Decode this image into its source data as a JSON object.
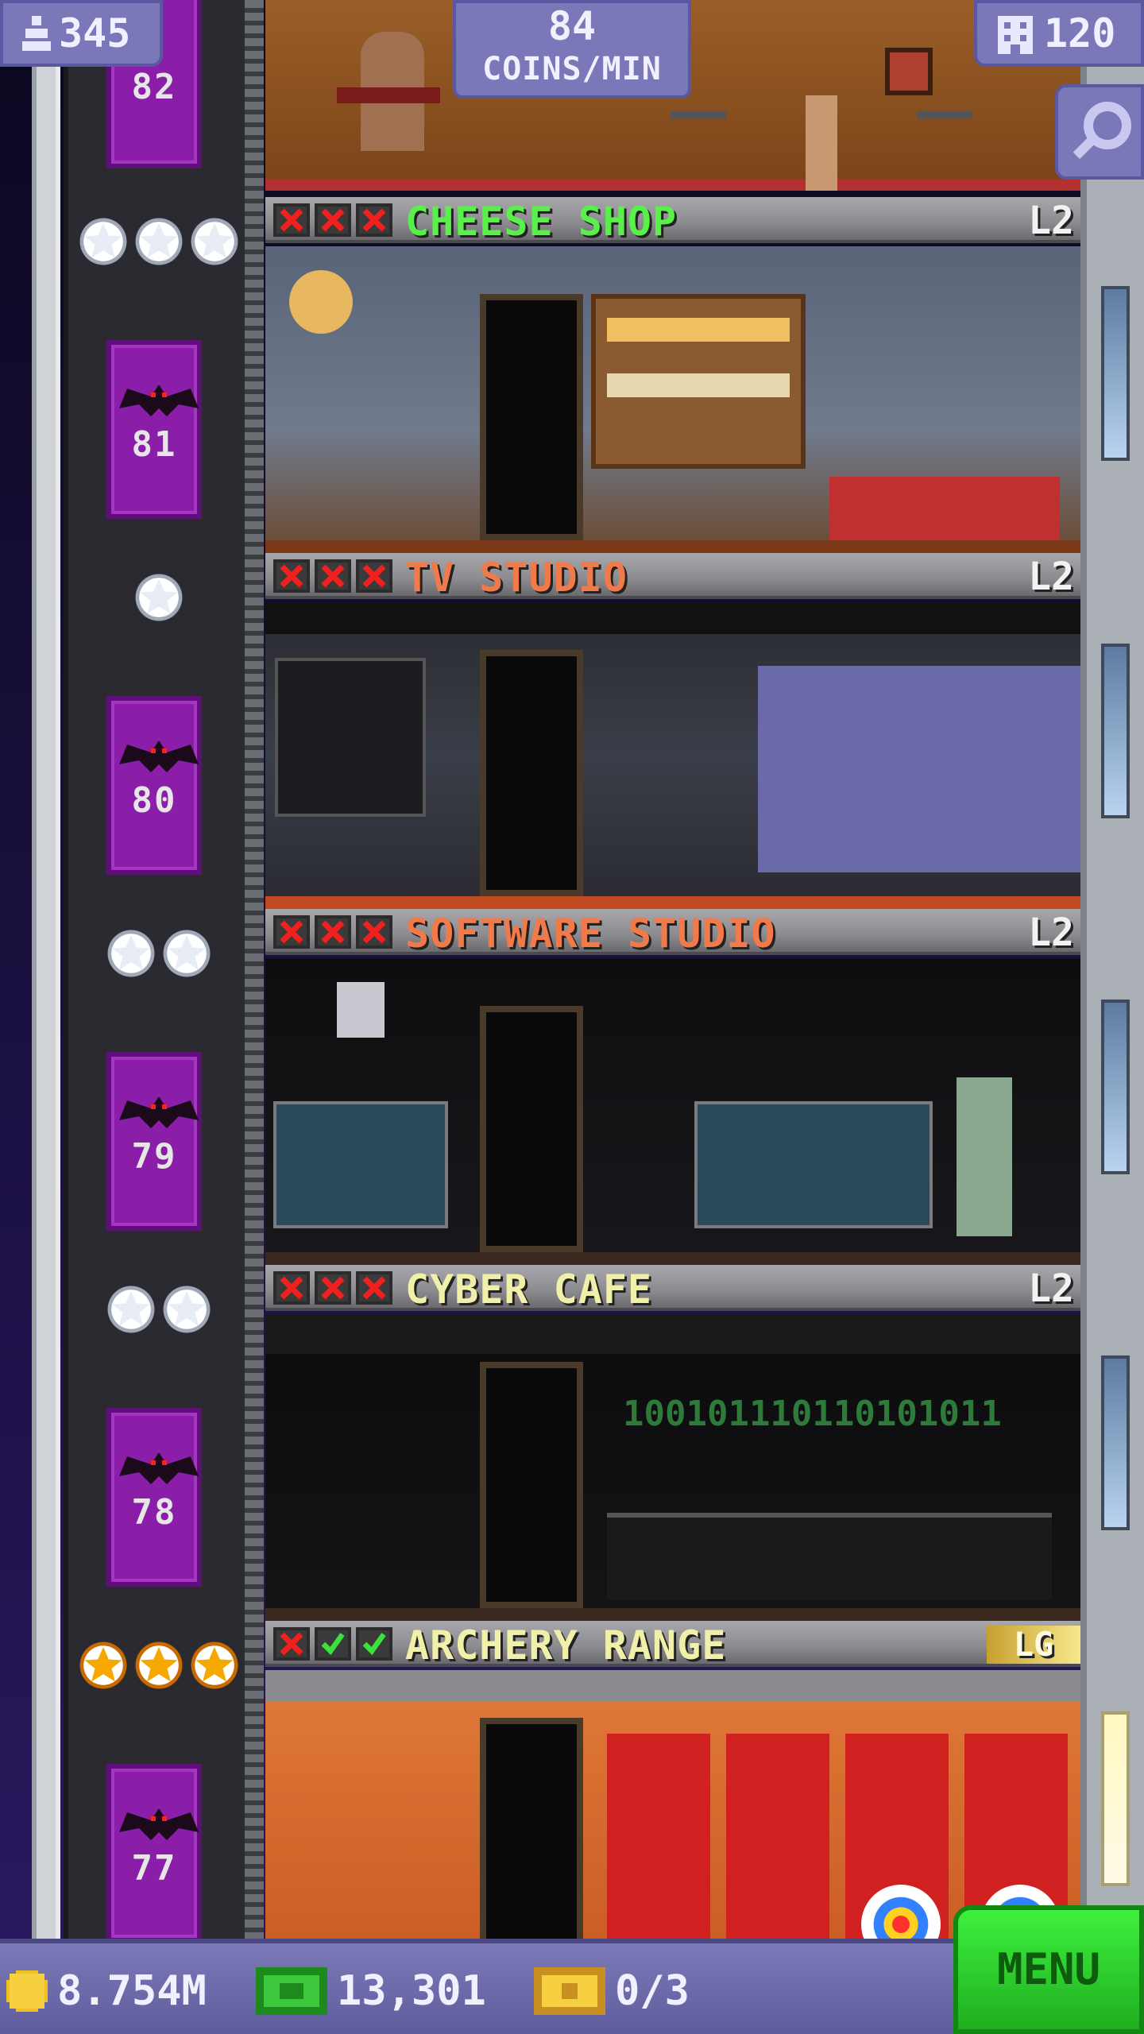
{
  "hud": {
    "population": "345",
    "income_value": "84",
    "income_unit": "COINS/MIN",
    "floors": "120"
  },
  "floors": [
    {
      "number": "82",
      "room_name": "",
      "level": "",
      "stars": 0
    },
    {
      "number": "81",
      "room_name": "CHEESE SHOP",
      "name_color": "#5af04a",
      "level": "L2",
      "stars": 3,
      "star_color": "silver",
      "checks": [
        false,
        false,
        false
      ]
    },
    {
      "number": "80",
      "room_name": "TV STUDIO",
      "name_color": "#f07a4a",
      "level": "L2",
      "stars": 1,
      "star_color": "silver",
      "checks": [
        false,
        false,
        false
      ]
    },
    {
      "number": "79",
      "room_name": "SOFTWARE STUDIO",
      "name_color": "#f07a4a",
      "level": "L2",
      "stars": 2,
      "star_color": "silver",
      "checks": [
        false,
        false,
        false
      ]
    },
    {
      "number": "78",
      "room_name": "CYBER CAFE",
      "name_color": "#f0f0a8",
      "level": "L2",
      "stars": 2,
      "star_color": "silver",
      "checks": [
        false,
        false,
        false
      ]
    },
    {
      "number": "77",
      "room_name": "ARCHERY RANGE",
      "name_color": "#f0f0a8",
      "level": "LG",
      "stars": 3,
      "star_color": "gold",
      "checks": [
        false,
        true,
        true
      ]
    }
  ],
  "cyber_cafe_sign": "100101110110101011",
  "bottom": {
    "coins": "8.754M",
    "bux": "13,301",
    "tickets": "0/3",
    "menu_label": "MENU"
  },
  "colors": {
    "hud_bg": "#7a78b8",
    "elevator": "#8a1ea8",
    "menu_green": "#2ed02e"
  }
}
